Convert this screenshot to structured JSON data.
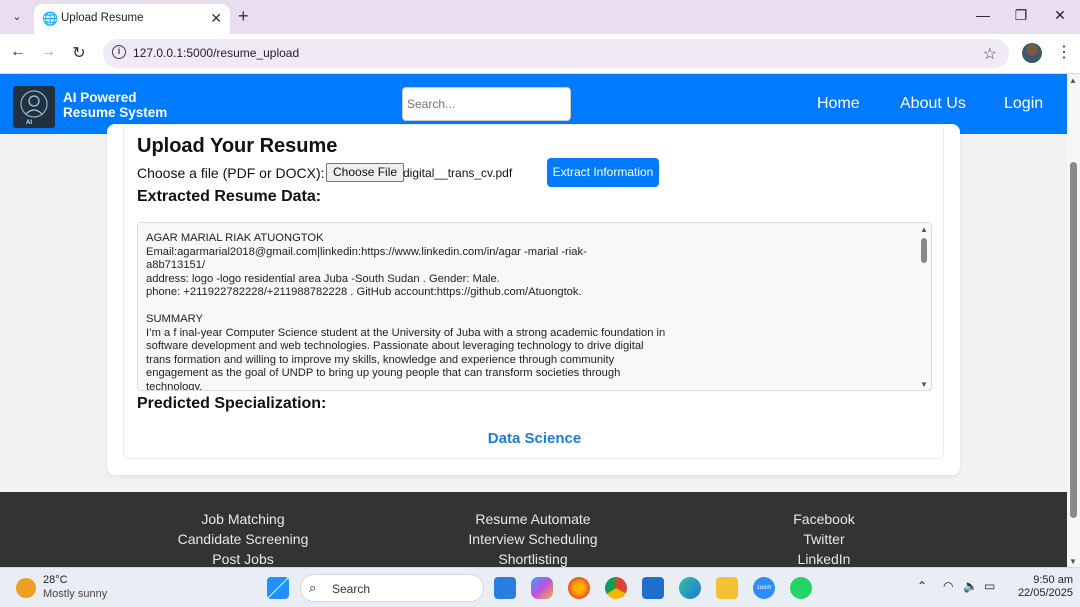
{
  "browser": {
    "tab_title": "Upload Resume",
    "url": "127.0.0.1:5000/resume_upload",
    "new_tab": "+",
    "close_tab": "✕"
  },
  "navbar": {
    "brand_line1": "AI Powered",
    "brand_line2": "Resume System",
    "logo_text": "AI",
    "search_placeholder": "Search...",
    "links": [
      "Home",
      "About Us",
      "Login"
    ]
  },
  "upload": {
    "heading": "Upload Your Resume",
    "choose_label": "Choose a file (PDF or DOCX):",
    "choose_button": "Choose File",
    "file_name": "digital__trans_cv.pdf",
    "extract_button": "Extract Information",
    "extracted_heading": "Extracted Resume Data:",
    "extracted_text": "AGAR MARIAL RIAK ATUONGTOK\nEmail:agarmarial2018@gmail.com|linkedin:https://www.linkedin.com/in/agar -marial -riak-\na8b713151/\naddress: logo -logo residential area Juba -South Sudan . Gender: Male.\nphone: +211922782228/+211988782228 . GitHub account:https://github.com/Atuongtok.\n\nSUMMARY\nI’m a f inal-year Computer Science student at the University of Juba with a strong academic foundation in\nsoftware development and web technologies. Passionate about leveraging technology to drive digital\ntrans formation and willing to improve my skills, knowledge and experience through community\nengagement as the goal of UNDP to bring up young people that can transform societies through\ntechnology.",
    "predicted_heading": "Predicted Specialization:",
    "prediction": "Data Science"
  },
  "footer": {
    "col1": [
      "Job Matching",
      "Candidate Screening",
      "Post Jobs"
    ],
    "col2": [
      "Resume Automate",
      "Interview Scheduling",
      "Shortlisting"
    ],
    "col3": [
      "Facebook",
      "Twitter",
      "LinkedIn"
    ]
  },
  "taskbar": {
    "temperature": "28°C",
    "condition": "Mostly sunny",
    "search_label": "Search",
    "time": "9:50 am",
    "date": "22/05/2025",
    "zoom_label": "zoom"
  },
  "colors": {
    "primary": "#007bff",
    "prediction": "#1a7fd8",
    "footer_bg": "#333333"
  }
}
